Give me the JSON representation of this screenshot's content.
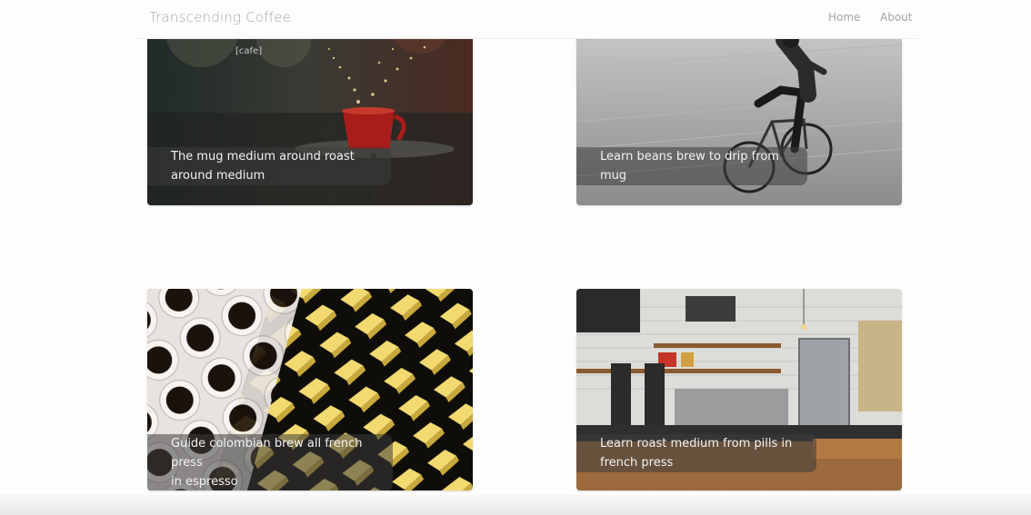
{
  "navbar": {
    "brand": "Transcending Coffee",
    "links": [
      "Home",
      "About"
    ]
  },
  "cards": [
    {
      "caption_line1": "The mug medium around roast",
      "caption_line2": "around medium",
      "tag": "[cafe]"
    },
    {
      "caption_line1": "Learn beans brew to drip from mug"
    },
    {
      "caption_line1": "Guide colombian brew all french press",
      "caption_line2": "in espresso"
    },
    {
      "caption_line1": "Learn roast medium from pills in",
      "caption_line2": "french press"
    }
  ]
}
